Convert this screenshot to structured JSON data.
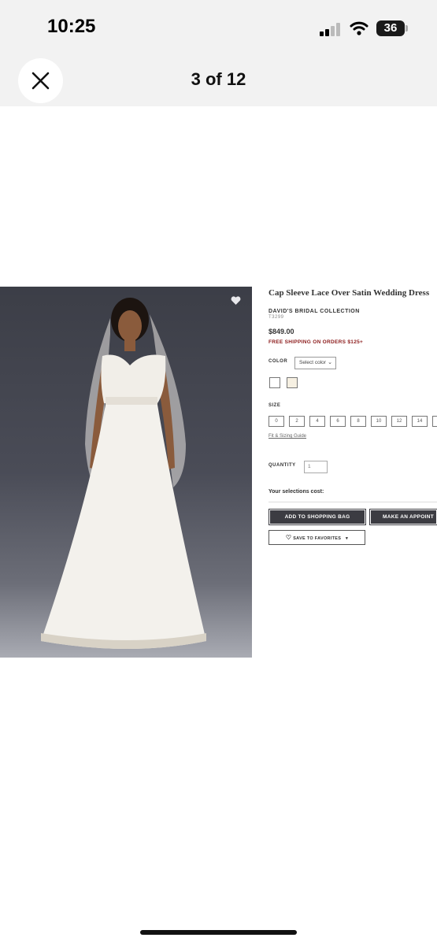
{
  "status_bar": {
    "time": "10:25",
    "battery": "36"
  },
  "header": {
    "title": "3 of 12"
  },
  "product": {
    "title": "Cap Sleeve Lace Over Satin Wedding Dress",
    "brand": "DAVID'S BRIDAL COLLECTION",
    "sku": "T3299",
    "price": "$849.00",
    "shipping": "FREE SHIPPING ON ORDERS $125+",
    "color_label": "COLOR",
    "color_select": "Select color",
    "swatch_colors": [
      "#ffffff",
      "#f6f0e2"
    ],
    "size_label": "SIZE",
    "sizes": [
      "0",
      "2",
      "4",
      "6",
      "8",
      "10",
      "12",
      "14"
    ],
    "fit_link": "Fit & Sizing Guide",
    "quantity_label": "QUANTITY",
    "quantity_value": "1",
    "selections_cost": "Your selections cost:",
    "add_to_bag": "ADD TO SHOPPING BAG",
    "make_appointment": "MAKE AN APPOINT",
    "save_favorites": "SAVE TO FAVORITES"
  }
}
